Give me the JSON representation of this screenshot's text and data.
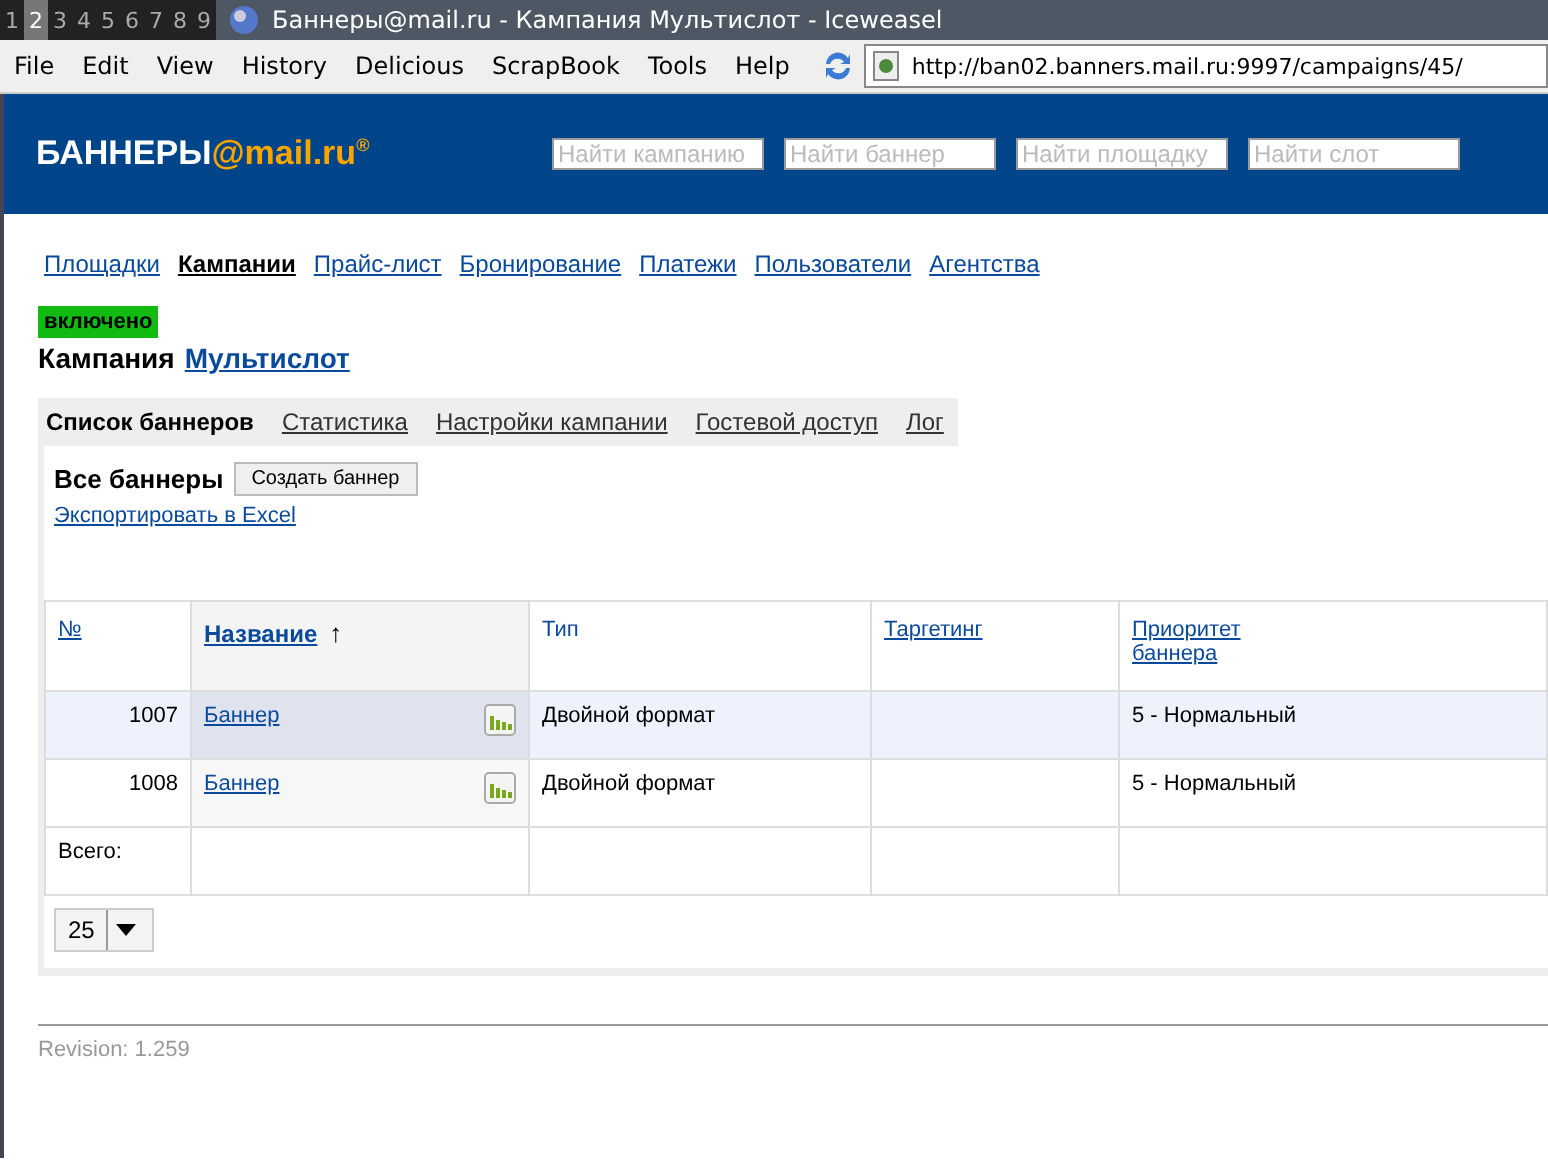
{
  "window": {
    "title": "Баннеры@mail.ru - Кампания Мультислот - Iceweasel",
    "workspaces": [
      {
        "label": "1",
        "selected": false
      },
      {
        "label": "2",
        "selected": true
      },
      {
        "label": "3",
        "selected": false
      },
      {
        "label": "4",
        "selected": false
      },
      {
        "label": "5",
        "selected": false
      },
      {
        "label": "6",
        "selected": false
      },
      {
        "label": "7",
        "selected": false
      },
      {
        "label": "8",
        "selected": false
      },
      {
        "label": "9",
        "selected": false
      }
    ]
  },
  "menu": [
    "File",
    "Edit",
    "View",
    "History",
    "Delicious",
    "ScrapBook",
    "Tools",
    "Help"
  ],
  "address": "http://ban02.banners.mail.ru:9997/campaigns/45/",
  "header": {
    "logo": "БАННЕРЫ",
    "logo_at": "@mail",
    "logo_ru": ".ru",
    "logo_mark": "®",
    "searches": [
      {
        "placeholder": "Найти кампанию"
      },
      {
        "placeholder": "Найти баннер"
      },
      {
        "placeholder": "Найти площадку"
      },
      {
        "placeholder": "Найти слот"
      }
    ]
  },
  "nav": [
    {
      "label": "Площадки",
      "selected": false
    },
    {
      "label": "Кампании",
      "selected": true
    },
    {
      "label": "Прайс-лист",
      "selected": false
    },
    {
      "label": "Бронирование",
      "selected": false
    },
    {
      "label": "Платежи",
      "selected": false
    },
    {
      "label": "Пользователи",
      "selected": false
    },
    {
      "label": "Агентства",
      "selected": false
    }
  ],
  "status": {
    "label": "включено",
    "color": "#11bb11"
  },
  "campaign": {
    "prefix": "Кампания",
    "name": "Мультислот"
  },
  "tabs": [
    {
      "label": "Список баннеров",
      "selected": true
    },
    {
      "label": "Статистика",
      "selected": false
    },
    {
      "label": "Настройки кампании",
      "selected": false
    },
    {
      "label": "Гостевой доступ",
      "selected": false
    },
    {
      "label": "Лог",
      "selected": false
    }
  ],
  "section": {
    "title": "Все баннеры",
    "create_button": "Создать баннер",
    "export_link": "Экспортировать в Excel"
  },
  "table": {
    "columns": [
      {
        "label": "№",
        "sorted": false
      },
      {
        "label": "Название",
        "sorted": true,
        "sort_arrow": "↑"
      },
      {
        "label": "Тип",
        "sorted": false,
        "link": false
      },
      {
        "label": "Таргетинг",
        "sorted": false
      },
      {
        "label": "Приоритет баннера",
        "sorted": false
      }
    ],
    "rows": [
      {
        "id": "1007",
        "name": "Баннер",
        "type": "Двойной формат",
        "priority": "5 - Нормальный",
        "selected": true
      },
      {
        "id": "1008",
        "name": "Баннер",
        "type": "Двойной формат",
        "priority": "5 - Нормальный",
        "selected": false
      }
    ],
    "total_label": "Всего:"
  },
  "page_size": "25",
  "footer": "Revision: 1.259"
}
